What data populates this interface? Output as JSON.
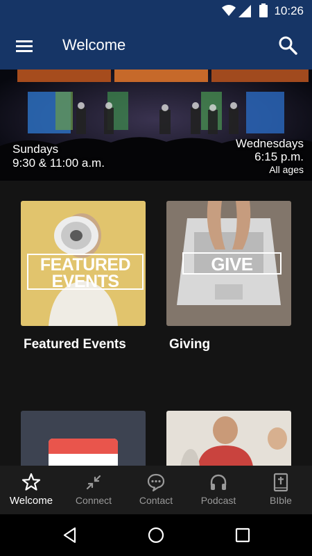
{
  "status_bar": {
    "time": "10:26"
  },
  "app_bar": {
    "title": "Welcome",
    "menu_icon": "menu-icon",
    "search_icon": "search-icon"
  },
  "hero": {
    "left_line1": "Sundays",
    "left_line2": "9:30 & 11:00 a.m.",
    "right_line1": "Wednesdays",
    "right_line2": "6:15 p.m.",
    "right_line3": "All ages"
  },
  "cards": [
    {
      "label": "Featured Events",
      "overlay_line1": "FEATURED",
      "overlay_line2": "EVENTS"
    },
    {
      "label": "Giving",
      "overlay": "GIVE"
    }
  ],
  "bottom_nav": [
    {
      "label": "Welcome",
      "icon": "star-icon",
      "active": true
    },
    {
      "label": "Connect",
      "icon": "connect-arrows-icon",
      "active": false
    },
    {
      "label": "Contact",
      "icon": "chat-icon",
      "active": false
    },
    {
      "label": "Podcast",
      "icon": "headphones-icon",
      "active": false
    },
    {
      "label": "BIble",
      "icon": "bible-icon",
      "active": false
    }
  ],
  "colors": {
    "app_bar": "#163566",
    "background": "#141414",
    "nav_bar": "#1c1c1c",
    "inactive": "#9a9a9a"
  }
}
